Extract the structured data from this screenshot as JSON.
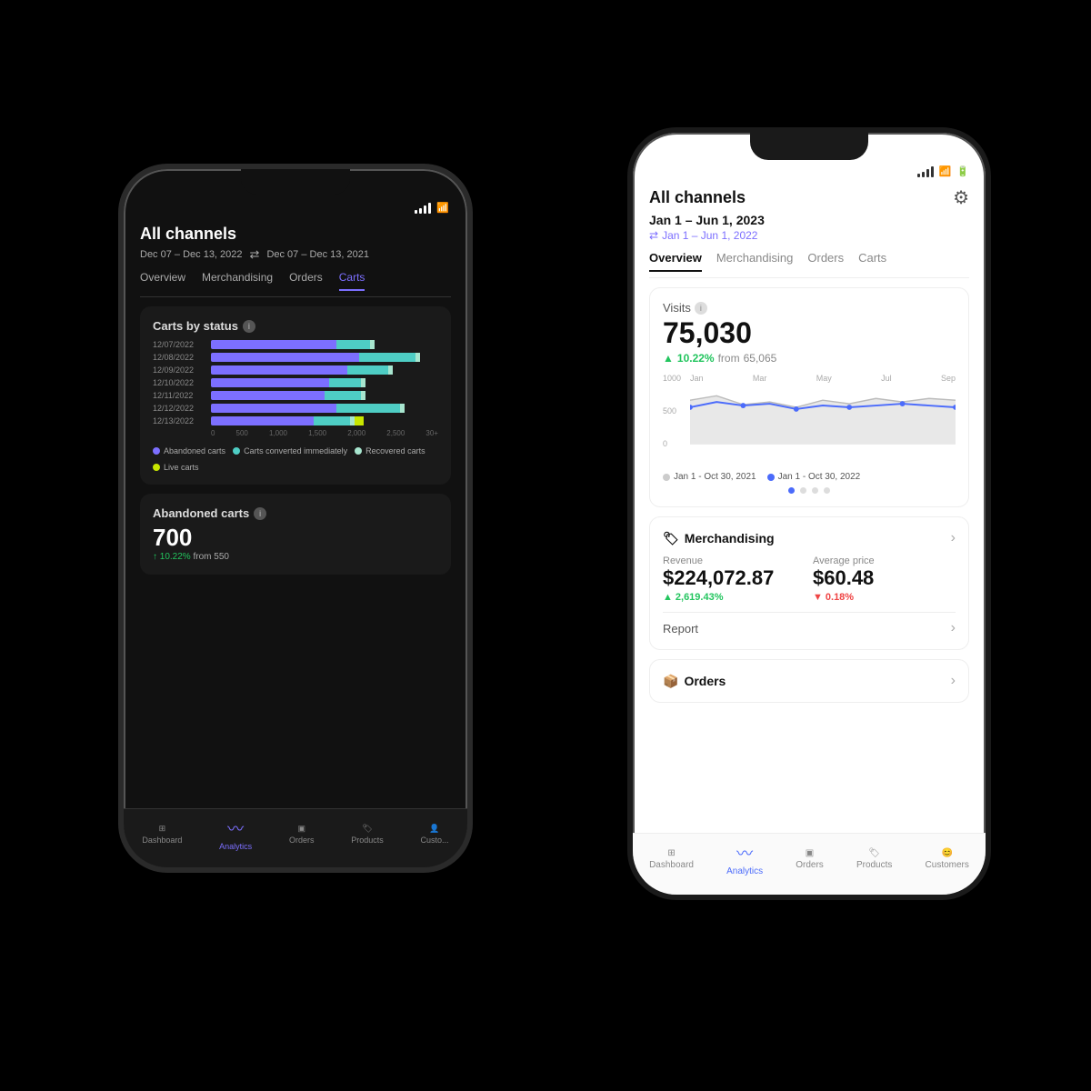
{
  "back_phone": {
    "allchannels": "All channels",
    "date_range": "Dec 07 – Dec 13, 2022",
    "compare_range": "Dec 07 – Dec 13, 2021",
    "tabs": [
      "Overview",
      "Merchandising",
      "Orders",
      "Carts"
    ],
    "active_tab": "Carts",
    "carts_by_status": {
      "title": "Carts by status",
      "rows": [
        {
          "label": "12/07/2022",
          "purple": 55,
          "teal": 15,
          "green": 2,
          "yellow": 0
        },
        {
          "label": "12/08/2022",
          "purple": 65,
          "teal": 25,
          "green": 2,
          "yellow": 0
        },
        {
          "label": "12/09/2022",
          "purple": 60,
          "teal": 18,
          "green": 2,
          "yellow": 0
        },
        {
          "label": "12/10/2022",
          "purple": 52,
          "teal": 14,
          "green": 2,
          "yellow": 0
        },
        {
          "label": "12/11/2022",
          "purple": 50,
          "teal": 16,
          "green": 2,
          "yellow": 0
        },
        {
          "label": "12/12/2022",
          "purple": 62,
          "teal": 28,
          "green": 2,
          "yellow": 0
        },
        {
          "label": "12/13/2022",
          "purple": 45,
          "teal": 16,
          "green": 2,
          "yellow": 4
        }
      ],
      "axis": [
        "0",
        "500",
        "1,000",
        "1,500",
        "2,000",
        "2,500",
        "30+"
      ],
      "legend": [
        {
          "color": "#7c6fff",
          "label": "Abandoned carts"
        },
        {
          "color": "#4ecdc4",
          "label": "Carts converted immediately"
        },
        {
          "color": "#a8e6cf",
          "label": "Recovered carts"
        },
        {
          "color": "#c8e600",
          "label": "Live carts"
        }
      ]
    },
    "abandoned_carts": {
      "title": "Abandoned carts",
      "value": "700",
      "change": "↑ 10.22% from 550"
    },
    "bottom_nav": [
      {
        "label": "Dashboard",
        "icon": "⊞",
        "active": false
      },
      {
        "label": "Analytics",
        "icon": "〜",
        "active": true
      },
      {
        "label": "Orders",
        "icon": "📦",
        "active": false
      },
      {
        "label": "Products",
        "icon": "🏷",
        "active": false
      },
      {
        "label": "Custo...",
        "icon": "👤",
        "active": false
      }
    ]
  },
  "front_phone": {
    "allchannels": "All channels",
    "date_primary": "Jan 1 – Jun 1, 2023",
    "date_compare": "Jan 1 – Jun 1, 2022",
    "tabs": [
      "Overview",
      "Merchandising",
      "Orders",
      "Carts"
    ],
    "active_tab": "Overview",
    "visits": {
      "label": "Visits",
      "value": "75,030",
      "change_pct": "10.22%",
      "from_val": "65,065",
      "chart": {
        "y_labels": [
          "1000",
          "500",
          "0"
        ],
        "x_labels": [
          "Jan",
          "Mar",
          "May",
          "Jul",
          "Sep"
        ],
        "legend_2021": "Jan 1 - Oct 30, 2021",
        "legend_2022": "Jan 1 - Oct 30, 2022"
      }
    },
    "merchandising": {
      "title": "Merchandising",
      "revenue_label": "Revenue",
      "revenue_val": "$224,072.87",
      "revenue_change": "2,619.43%",
      "avg_price_label": "Average price",
      "avg_price_val": "$60.48",
      "avg_price_change": "0.18%",
      "report_label": "Report"
    },
    "orders": {
      "title": "Orders"
    },
    "bottom_nav": [
      {
        "label": "Dashboard",
        "icon": "⊞",
        "active": false
      },
      {
        "label": "Analytics",
        "icon": "〜",
        "active": true
      },
      {
        "label": "Orders",
        "icon": "📦",
        "active": false
      },
      {
        "label": "Products",
        "icon": "🏷",
        "active": false
      },
      {
        "label": "Customers",
        "icon": "😊",
        "active": false
      }
    ]
  }
}
